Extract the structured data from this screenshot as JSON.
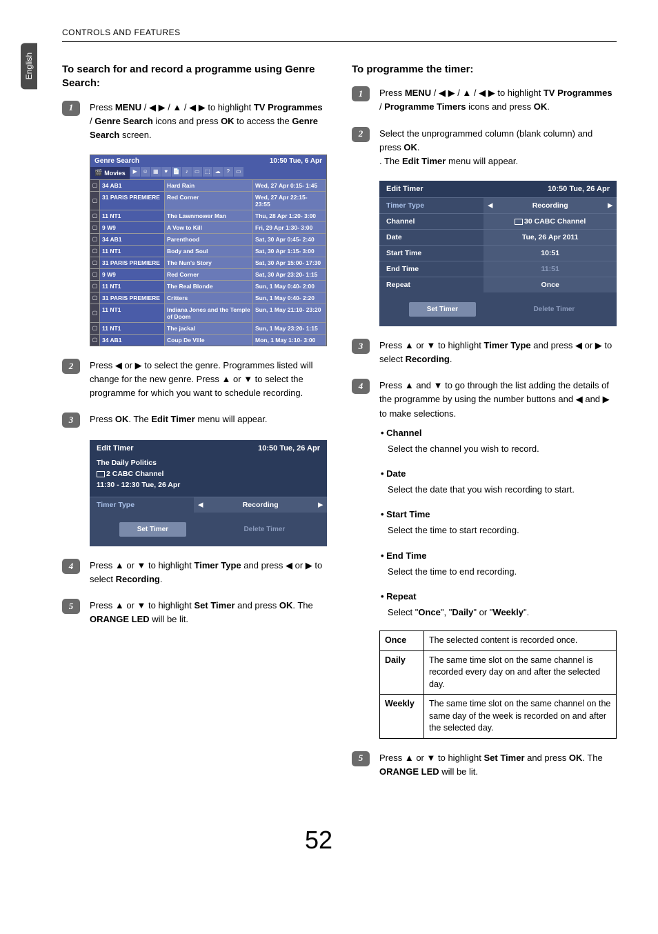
{
  "header": "CONTROLS AND FEATURES",
  "sideTab": "English",
  "pageNumber": "52",
  "left": {
    "heading": "To search for and record a programme using Genre Search:",
    "step1_a": "Press ",
    "step1_menu": "MENU",
    "step1_b": " / ",
    "step1_c": " to highlight ",
    "step1_tvprog": "TV Programmes",
    "step1_slash": " / ",
    "step1_genre": "Genre Search",
    "step1_d": " icons and press ",
    "step1_ok": "OK",
    "step1_e": " to access the ",
    "step1_f": " screen.",
    "genreSearch": {
      "title": "Genre Search",
      "time": "10:50 Tue, 6 Apr",
      "movies": "Movies",
      "rows": [
        {
          "ch": "34 AB1",
          "prog": "Hard Rain",
          "t": "Wed, 27 Apr  0:15- 1:45"
        },
        {
          "ch": "31 PARIS PREMIERE",
          "prog": "Red Corner",
          "t": "Wed, 27 Apr 22:15- 23:55"
        },
        {
          "ch": "11 NT1",
          "prog": "The Lawnmower Man",
          "t": "Thu, 28 Apr  1:20- 3:00"
        },
        {
          "ch": "9    W9",
          "prog": "A Vow to Kill",
          "t": "Fri, 29 Apr  1:30- 3:00"
        },
        {
          "ch": "34 AB1",
          "prog": "Parenthood",
          "t": "Sat, 30 Apr  0:45- 2:40"
        },
        {
          "ch": "11 NT1",
          "prog": "Body and Soul",
          "t": "Sat, 30 Apr  1:15- 3:00"
        },
        {
          "ch": "31 PARIS PREMIERE",
          "prog": "The Nun's Story",
          "t": "Sat, 30 Apr 15:00- 17:30"
        },
        {
          "ch": "9    W9",
          "prog": "Red Corner",
          "t": "Sat, 30 Apr 23:20- 1:15"
        },
        {
          "ch": "11 NT1",
          "prog": "The Real Blonde",
          "t": "Sun, 1 May  0:40-  2:00"
        },
        {
          "ch": "31 PARIS PREMIERE",
          "prog": "Critters",
          "t": "Sun, 1 May  0:40-  2:20"
        },
        {
          "ch": "11 NT1",
          "prog": "Indiana Jones and the Temple of Doom",
          "t": "Sun, 1 May 21:10- 23:20"
        },
        {
          "ch": "11 NT1",
          "prog": "The jackal",
          "t": "Sun, 1 May 23:20-  1:15"
        },
        {
          "ch": "34 AB1",
          "prog": "Coup De Ville",
          "t": "Mon, 1 May  1:10-  3:00"
        }
      ]
    },
    "step2_a": "Press ",
    "step2_b": " or ",
    "step2_c": " to select the genre. Programmes listed will change for the new genre. Press ",
    "step2_d": " or ",
    "step2_e": " to select the programme for which you want to schedule recording.",
    "step3_a": "Press ",
    "step3_ok": "OK",
    "step3_b": ". The ",
    "step3_et": "Edit Timer",
    "step3_c": " menu will appear.",
    "editTimer1": {
      "title": "Edit Timer",
      "time": "10:50 Tue, 26 Apr",
      "sub1": "The Daily Politics",
      "sub2": "2 CABC Channel",
      "sub3": "11:30 - 12:30 Tue, 26 Apr",
      "timerType": "Timer Type",
      "recording": "Recording",
      "setTimer": "Set Timer",
      "deleteTimer": "Delete Timer"
    },
    "step4_a": "Press ",
    "step4_b": " or ",
    "step4_c": " to highlight ",
    "step4_tt": "Timer Type",
    "step4_d": " and press ",
    "step4_e": " or ",
    "step4_f": " to select ",
    "step4_rec": "Recording",
    "step4_g": ".",
    "step5_a": "Press ",
    "step5_b": " or ",
    "step5_c": " to highlight ",
    "step5_st": "Set Timer",
    "step5_d": " and press ",
    "step5_ok": "OK",
    "step5_e": ". The ",
    "step5_led": "ORANGE LED",
    "step5_f": " will be lit."
  },
  "right": {
    "heading": "To programme the timer:",
    "step1_a": "Press ",
    "step1_menu": "MENU",
    "step1_b": " / ",
    "step1_c": " to highlight ",
    "step1_tvprog": "TV Programmes",
    "step1_slash": " / ",
    "step1_pt": "Programme Timers",
    "step1_d": " icons and press ",
    "step1_ok": "OK",
    "step1_e": ".",
    "step2_a": "Select the unprogrammed column (blank column) and press ",
    "step2_ok": "OK",
    "step2_b": ". The ",
    "step2_et": "Edit Timer",
    "step2_c": " menu will appear.",
    "editTimer2": {
      "title": "Edit Timer",
      "time": "10:50 Tue, 26 Apr",
      "rows": [
        {
          "l": "Timer Type",
          "v": "Recording",
          "arrows": true,
          "blue": true
        },
        {
          "l": "Channel",
          "v": "30 CABC Channel"
        },
        {
          "l": "Date",
          "v": "Tue, 26 Apr 2011"
        },
        {
          "l": "Start Time",
          "v": "10:51"
        },
        {
          "l": "End Time",
          "v": "11:51",
          "dim": true
        },
        {
          "l": "Repeat",
          "v": "Once"
        }
      ],
      "setTimer": "Set Timer",
      "deleteTimer": "Delete Timer"
    },
    "step3_a": "Press ",
    "step3_b": " or ",
    "step3_c": " to highlight ",
    "step3_tt": "Timer Type",
    "step3_d": " and press ",
    "step3_e": " or ",
    "step3_f": " to select ",
    "step3_rec": "Recording",
    "step3_g": ".",
    "step4_a": "Press ",
    "step4_b": " and ",
    "step4_c": " to go through the list adding the details of the programme by using the number buttons and ",
    "step4_d": " and ",
    "step4_e": " to make selections.",
    "bullets": [
      {
        "h": "Channel",
        "t": "Select the channel you wish to record."
      },
      {
        "h": "Date",
        "t": "Select the date that you wish recording to start."
      },
      {
        "h": "Start Time",
        "t": "Select the time to start recording."
      },
      {
        "h": "End Time",
        "t": "Select the time to end recording."
      },
      {
        "h": "Repeat",
        "t": "Select \"Once\", \"Daily\" or \"Weekly\"."
      }
    ],
    "repeatTable": [
      {
        "k": "Once",
        "v": "The selected content is recorded once."
      },
      {
        "k": "Daily",
        "v": "The same time slot on the same channel is recorded every day on and after the selected day."
      },
      {
        "k": "Weekly",
        "v": "The same time slot on the same channel on the same day of the week is recorded on and after the selected day."
      }
    ],
    "step5_a": "Press ",
    "step5_b": " or ",
    "step5_c": " to highlight ",
    "step5_st": "Set Timer",
    "step5_d": " and press ",
    "step5_ok": "OK",
    "step5_e": ". The ",
    "step5_led": "ORANGE LED",
    "step5_f": " will be lit."
  }
}
